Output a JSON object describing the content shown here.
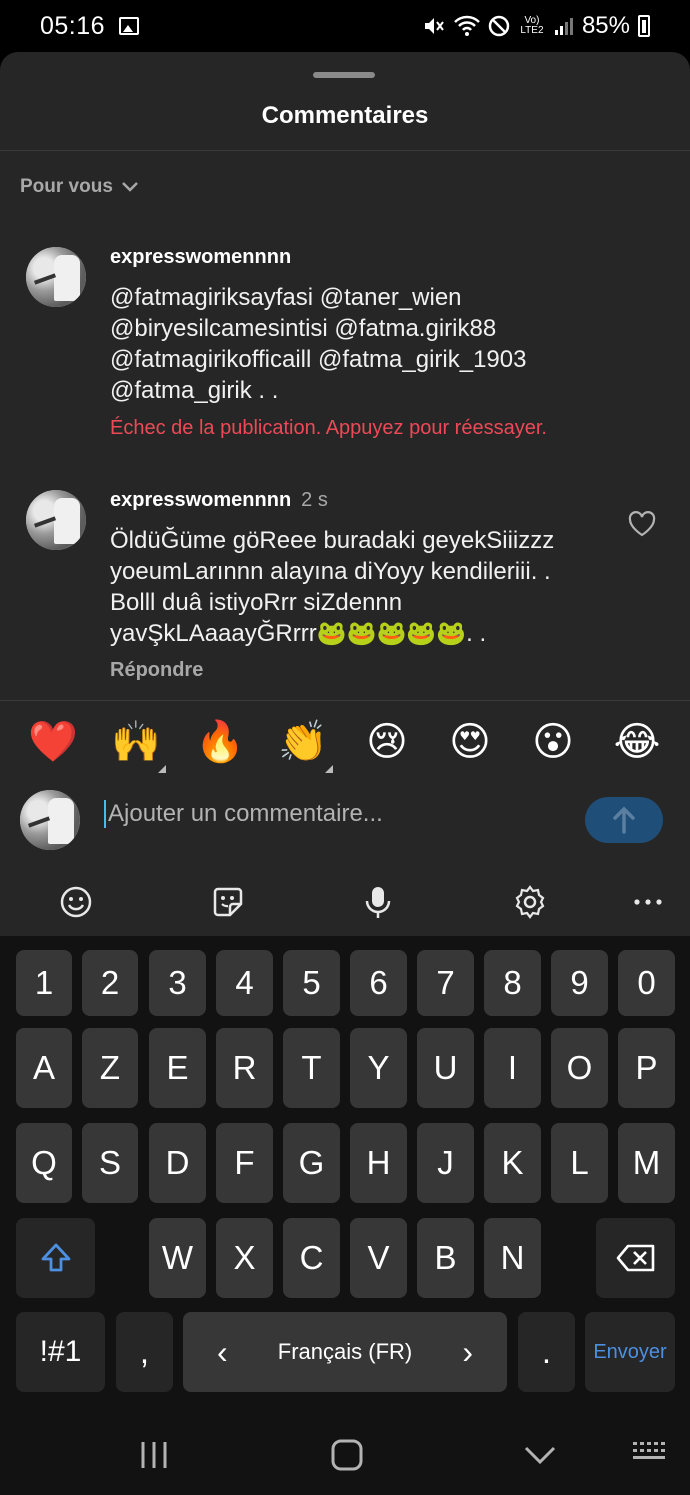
{
  "status_bar": {
    "time": "05:16",
    "network": "Vo) LTE2",
    "battery": "85%"
  },
  "sheet": {
    "title": "Commentaires",
    "filter_label": "Pour vous"
  },
  "comments": [
    {
      "username": "expresswomennnn",
      "time": "",
      "lines": [
        "@fatmagiriksayfasi @taner_wien",
        "@biryesilcamesintisi @fatma.girik88",
        "@fatmagirikofficaill @fatma_girik_1903",
        "@fatma_girik . ."
      ],
      "error": "Échec de la publication. Appuyez pour réessayer."
    },
    {
      "username": "expresswomennnn",
      "time": "2 s",
      "lines": [
        "ÖldüĞüme göReee buradaki geyekSiiizzz",
        "yoeumLarınnn alayına diYoyy kendileriii. .",
        "Bolll duâ istiyoRrr siZdennn",
        "yavŞkLAaaayĞRrrr🐸🐸🐸🐸🐸. ."
      ],
      "reply_label": "Répondre"
    }
  ],
  "emoji_bar": [
    "❤️",
    "🙌",
    "🔥",
    "👏",
    "😢",
    "😍",
    "😮",
    "😂"
  ],
  "input": {
    "placeholder": "Ajouter un commentaire..."
  },
  "keyboard": {
    "row_numbers": [
      "1",
      "2",
      "3",
      "4",
      "5",
      "6",
      "7",
      "8",
      "9",
      "0"
    ],
    "row_1": [
      "A",
      "Z",
      "E",
      "R",
      "T",
      "Y",
      "U",
      "I",
      "O",
      "P"
    ],
    "row_2": [
      "Q",
      "S",
      "D",
      "F",
      "G",
      "H",
      "J",
      "K",
      "L",
      "M"
    ],
    "row_3": [
      "W",
      "X",
      "C",
      "V",
      "B",
      "N"
    ],
    "symbols_label": "!#1",
    "comma": ",",
    "language": "Français (FR)",
    "lang_prev": "‹",
    "lang_next": "›",
    "period": ".",
    "send_label": "Envoyer"
  },
  "icons": {
    "toolbar": [
      "emoji-icon",
      "sticker-icon",
      "microphone-icon",
      "settings-icon",
      "more-icon"
    ],
    "nav": [
      "recent-apps-icon",
      "home-icon",
      "back-icon",
      "keyboard-icon"
    ]
  }
}
